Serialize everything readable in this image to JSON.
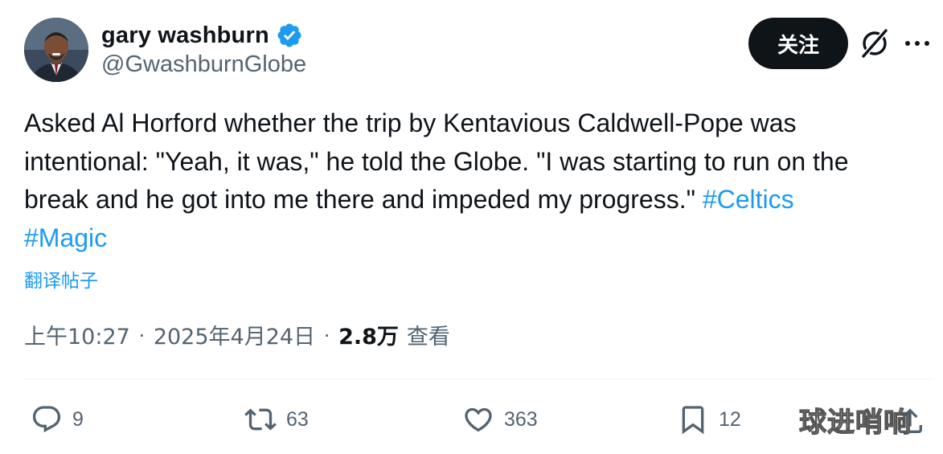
{
  "author": {
    "display_name": "gary washburn",
    "handle": "@GwashburnGlobe",
    "verified": true,
    "avatar_icon": "profile-photo"
  },
  "header": {
    "follow_label": "关注",
    "grok_icon": "grok-icon",
    "more_icon": "more-dots-icon"
  },
  "tweet": {
    "text_line1": "Asked Al Horford whether the trip by Kentavious Caldwell-Pope was",
    "text_line2": "intentional: \"Yeah, it was,\" he told the Globe. \"I was starting to run on the",
    "text_line3": "break and he got into me there and impeded my progress.\" ",
    "hashtag1": "#Celtics",
    "hashtag2": "#Magic",
    "translate_label": "翻译帖子"
  },
  "meta": {
    "time": "上午10:27",
    "separator": "·",
    "date": "2025年4月24日",
    "views_count": "2.8万",
    "views_label": "查看"
  },
  "actions": {
    "replies": "9",
    "reposts": "63",
    "likes": "363",
    "bookmarks": "12"
  },
  "watermark": "球进哨响",
  "colors": {
    "text": "#0f1419",
    "secondary": "#536471",
    "accent": "#1d9bf0",
    "button_bg": "#0f1419"
  }
}
